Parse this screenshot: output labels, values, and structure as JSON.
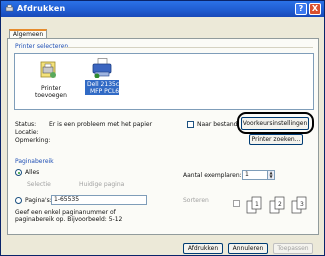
{
  "window": {
    "title": "Afdrukken",
    "help": "?",
    "close": "X"
  },
  "tabs": [
    {
      "label": "Algemeen"
    }
  ],
  "printer_select": {
    "group_label": "Printer selecteren",
    "items": [
      {
        "label_line1": "Printer",
        "label_line2": "toevoegen",
        "icon": "add-printer-icon"
      },
      {
        "label_line1": "Dell 2135cn",
        "label_line2": "MFP PCL6",
        "icon": "printer-icon",
        "selected": true
      }
    ]
  },
  "status": {
    "status_label": "Status:",
    "status_value": "Er is een probleem met het papier",
    "location_label": "Locatie:",
    "comment_label": "Opmerking:",
    "print_to_file_label": "Naar bestand",
    "preferences_button": "Voorkeursinstellingen",
    "find_printer_button": "Printer zoeken..."
  },
  "page_range": {
    "group_label": "Paginabereik",
    "all_label": "Alles",
    "selection_label": "Selectie",
    "current_page_label": "Huidige pagina",
    "pages_label": "Pagina's:",
    "pages_value": "1-65535",
    "hint_line1": "Geef een enkel paginanummer of",
    "hint_line2": "paginabereik op. Bijvoorbeeld: 5-12"
  },
  "copies": {
    "label": "Aantal exemplaren:",
    "value": "1",
    "collate_label": "Sorteren"
  },
  "footer": {
    "print_button": "Afdrukken",
    "cancel_button": "Annuleren",
    "apply_button": "Toepassen"
  },
  "colors": {
    "accent": "#1f5bd0",
    "highlight": "#000000"
  }
}
